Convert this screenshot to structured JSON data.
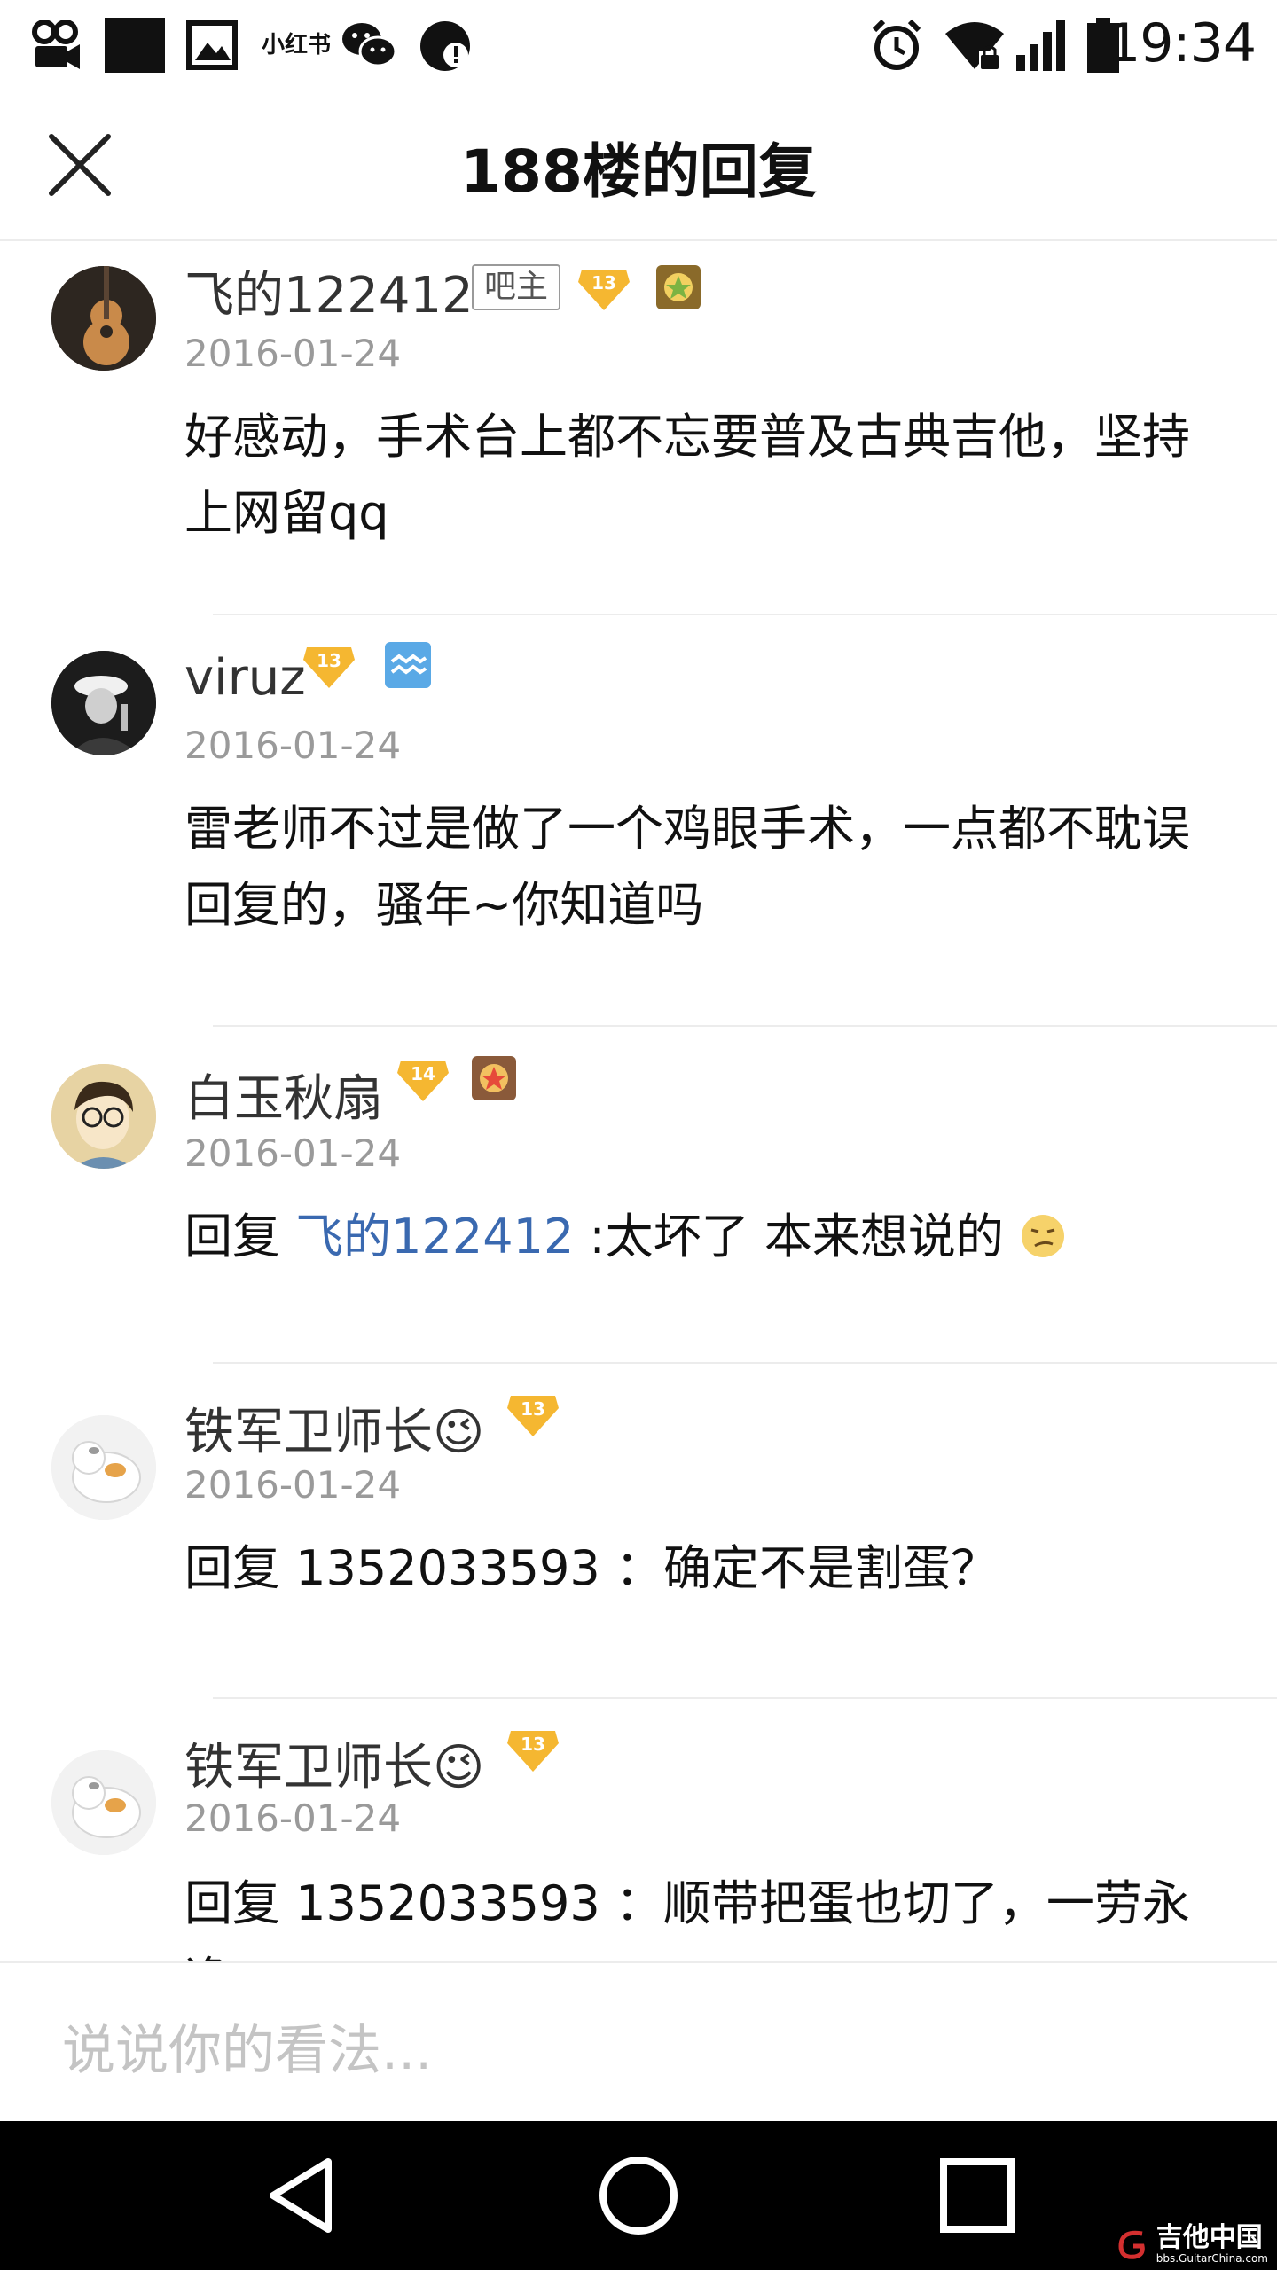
{
  "status_bar": {
    "time": "19:34",
    "xiaohongshu_label": "小红书",
    "icons": [
      "video-camera-icon",
      "black-square-icon",
      "gallery-icon",
      "xiaohongshu-icon",
      "wechat-icon",
      "alert-icon",
      "alarm-icon",
      "wifi-lock-icon",
      "signal-icon",
      "battery-icon"
    ]
  },
  "header": {
    "title": "188楼的回复",
    "close_icon": "close-icon"
  },
  "comments": [
    {
      "username": "飞的122412",
      "role": "吧主",
      "level": "13",
      "date": "2016-01-24",
      "text": "好感动，手术台上都不忘要普及古典吉他，坚持上网留qq"
    },
    {
      "username": "viruz",
      "level": "13",
      "date": "2016-01-24",
      "text": "雷老师不过是做了一个鸡眼手术，一点都不耽误回复的，骚年~你知道吗"
    },
    {
      "username": "白玉秋扇",
      "level": "14",
      "date": "2016-01-24",
      "reply_prefix": "回复 ",
      "reply_to": "飞的122412",
      "text": " :太坏了 本来想说的"
    },
    {
      "username": "铁军卫师长😉",
      "level": "13",
      "date": "2016-01-24",
      "reply_prefix": "回复 ",
      "reply_to": "1352033593",
      "text": " ：确定不是割蛋？"
    },
    {
      "username": "铁军卫师长😉",
      "level": "13",
      "date": "2016-01-24",
      "reply_prefix": "回复 ",
      "reply_to": "1352033593",
      "text": " ：顺带把蛋也切了，一劳永逸"
    }
  ],
  "input": {
    "placeholder": "说说你的看法..."
  },
  "nav": {
    "back_icon": "back-triangle-icon",
    "home_icon": "home-circle-icon",
    "recents_icon": "recents-square-icon"
  },
  "watermark": {
    "main": "吉他中国",
    "sub": "bbs.GuitarChina.com"
  },
  "colors": {
    "reply_link": "#3a69b0",
    "date": "#9a9a9a",
    "level_badge": "#f5b731",
    "nav_bg": "#000000"
  }
}
